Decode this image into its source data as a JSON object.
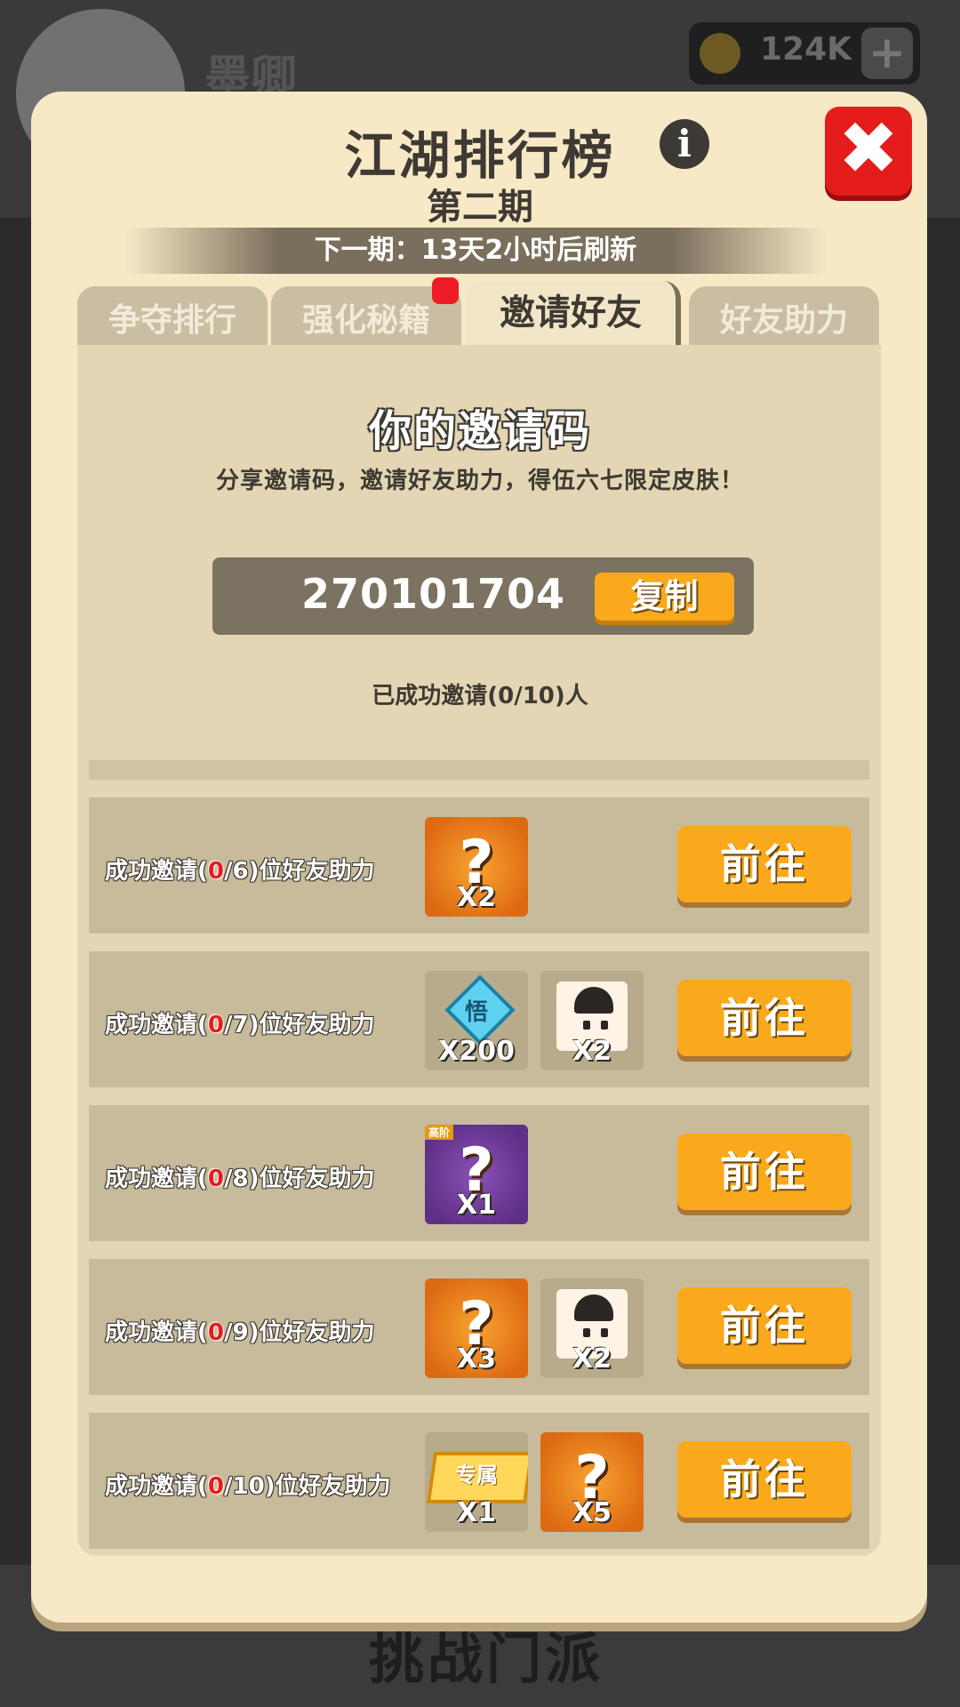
{
  "background": {
    "player_name": "墨卿",
    "coins": "124K",
    "bottom_title": "挑战门派"
  },
  "dialog": {
    "title": "江湖排行榜",
    "subtitle": "第二期",
    "refresh_text": "下一期：13天2小时后刷新",
    "info_icon": "i",
    "close_icon": "✖",
    "tabs": [
      {
        "label": "争夺排行",
        "active": false
      },
      {
        "label": "强化秘籍",
        "active": false,
        "has_notification": true
      },
      {
        "label": "邀请好友",
        "active": true
      },
      {
        "label": "好友助力",
        "active": false
      }
    ]
  },
  "invite": {
    "heading": "你的邀请码",
    "description": "分享邀请码，邀请好友助力，得伍六七限定皮肤！",
    "code": "270101704",
    "copy_label": "复制",
    "invited_status": "已成功邀请(0/10)人"
  },
  "rows": [
    {
      "prefix": "成功邀请(",
      "current": "0",
      "suffix": "/6)位好友助力",
      "go": "前往",
      "rewards": [
        {
          "type": "mystery-skin",
          "qty": "X2"
        }
      ]
    },
    {
      "prefix": "成功邀请(",
      "current": "0",
      "suffix": "/7)位好友助力",
      "go": "前往",
      "rewards": [
        {
          "type": "gem",
          "label": "悟",
          "qty": "X200"
        },
        {
          "type": "character",
          "qty": "X2"
        }
      ]
    },
    {
      "prefix": "成功邀请(",
      "current": "0",
      "suffix": "/8)位好友助力",
      "go": "前往",
      "rewards": [
        {
          "type": "mystery-purple",
          "tag": "高阶",
          "qty": "X1"
        }
      ]
    },
    {
      "prefix": "成功邀请(",
      "current": "0",
      "suffix": "/9)位好友助力",
      "go": "前往",
      "rewards": [
        {
          "type": "mystery-skin",
          "qty": "X3"
        },
        {
          "type": "character",
          "qty": "X2"
        }
      ]
    },
    {
      "prefix": "成功邀请(",
      "current": "0",
      "suffix": "/10)位好友助力",
      "go": "前往",
      "rewards": [
        {
          "type": "exclusive-badge",
          "label": "专属",
          "qty": "X1"
        },
        {
          "type": "mystery-weapon",
          "qty": "X5"
        }
      ]
    }
  ],
  "colors": {
    "dialog_bg": "#f8e9c6",
    "button_orange": "#f9a91b",
    "close_red": "#e51c1c",
    "count_red": "#e71c1c"
  }
}
